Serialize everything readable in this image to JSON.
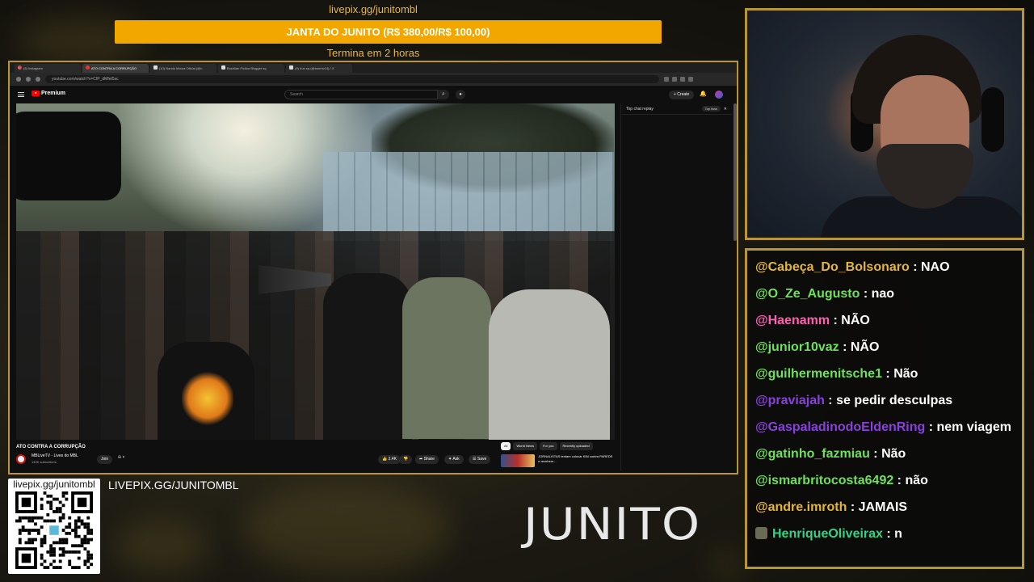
{
  "colors": {
    "accent_gold": "#b89535",
    "goal_orange": "#f2a600",
    "pix_text": "#e8b64a"
  },
  "donation": {
    "url": "livepix.gg/junitombl",
    "goal_label": "JANTA DO JUNITO (R$ 380,00/R$ 100,00)",
    "ends_label": "Termina em 2 horas"
  },
  "browser": {
    "tabs": [
      {
        "label": "(8) Instagram",
        "icon": "instagram-icon"
      },
      {
        "label": "ATO CONTRA A CORRUPÇÃO",
        "icon": "youtube-icon",
        "active": true
      },
      {
        "label": "(10) Nando Moura Oficial (@n",
        "icon": "x-icon"
      },
      {
        "label": "Brazilian Fiction Blogger sq",
        "icon": "x-icon"
      },
      {
        "label": "(9) Irun sq (@irunmv14) / X",
        "icon": "x-icon"
      }
    ],
    "url": "youtube.com/watch?v=CIP_dMfet5sc"
  },
  "youtube": {
    "logo_text": "Premium",
    "search_placeholder": "Search",
    "create_label": "+ Create",
    "chat_mode": "Top chat replay",
    "chat_pill": "Top fans",
    "video_title": "ATO CONTRA A CORRUPÇÃO",
    "channel_name": "MBLiveTV - Lives do MBL",
    "subscribers": "140K subscribers",
    "join_label": "Join",
    "likes": "2.4K",
    "share_label": "Share",
    "ask_label": "Ask",
    "save_label": "Save",
    "chips": [
      "All",
      "World News",
      "For you",
      "Recently uploaded"
    ],
    "rec_title": "JORNALISTAS tentam colocar KIM contra PAREDE e recebem..."
  },
  "chat": {
    "messages": [
      {
        "user": "@Cabeça_Do_Bolsonaro",
        "text": "NAO",
        "color": "#e4b73a"
      },
      {
        "user": "@O_Ze_Augusto",
        "text": "nao",
        "color": "#6ee05a"
      },
      {
        "user": "@Haenamm",
        "text": "NÃO",
        "color": "#ff5eb4"
      },
      {
        "user": "@junior10vaz",
        "text": "NÃO",
        "color": "#6ee05a"
      },
      {
        "user": "@guilhermenitsche1",
        "text": "Não",
        "color": "#6ee05a"
      },
      {
        "user": "@praviajah",
        "text": "se pedir desculpas",
        "color": "#8a3fe0"
      },
      {
        "user": "@GaspaladinodoEldenRing",
        "text": "nem viagem",
        "color": "#8a3fe0",
        "wrap": true
      },
      {
        "user": "@gatinho_fazmiau",
        "text": "Não",
        "color": "#6ee05a"
      },
      {
        "user": "@ismarbritocosta6492",
        "text": "não",
        "color": "#6ee05a"
      },
      {
        "user": "@andre.imroth",
        "text": "JAMAIS",
        "color": "#e4b73a"
      },
      {
        "user": "HenriqueOliveirax",
        "text": "n",
        "color": "#2fd48a",
        "badge": true
      }
    ]
  },
  "footer": {
    "qr_url": "livepix.gg/junitombl",
    "livepix_link": "LIVEPIX.GG/JUNITOMBL",
    "brand": "JUNITO"
  }
}
